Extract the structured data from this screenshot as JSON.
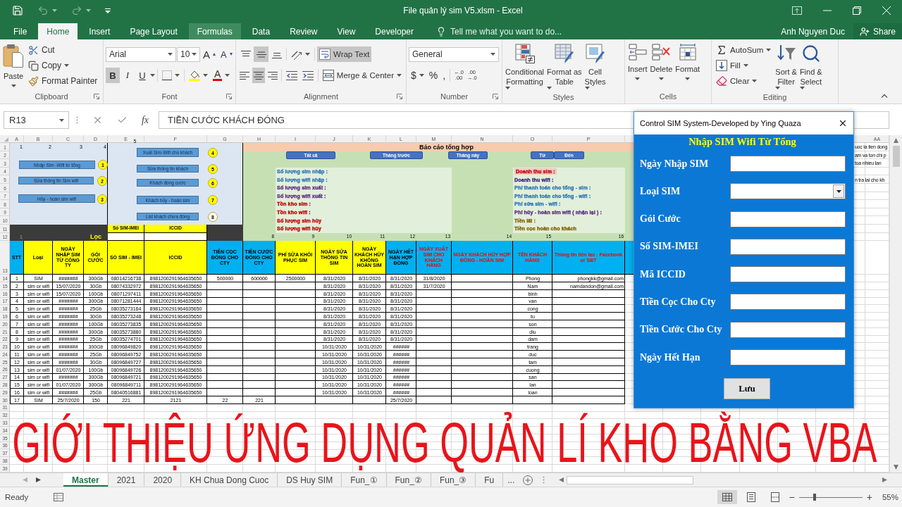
{
  "title_bar": {
    "title": "File quản lý sim V5.xlsm - Excel",
    "quick_access": [
      {
        "kind": "save",
        "disabled": false
      },
      {
        "kind": "undo",
        "disabled": true
      },
      {
        "kind": "redo",
        "disabled": true
      }
    ]
  },
  "ribbon_tabs": [
    {
      "label": "File",
      "selected": false,
      "highlighted": false
    },
    {
      "label": "Home",
      "selected": true,
      "highlighted": false
    },
    {
      "label": "Insert",
      "selected": false,
      "highlighted": false
    },
    {
      "label": "Page Layout",
      "selected": false,
      "highlighted": false
    },
    {
      "label": "Formulas",
      "selected": false,
      "highlighted": true
    },
    {
      "label": "Data",
      "selected": false,
      "highlighted": false
    },
    {
      "label": "Review",
      "selected": false,
      "highlighted": false
    },
    {
      "label": "View",
      "selected": false,
      "highlighted": false
    },
    {
      "label": "Developer",
      "selected": false,
      "highlighted": false
    }
  ],
  "tell_me": {
    "placeholder": "Tell me what you want to do..."
  },
  "account": {
    "user": "Anh Nguyen Duc",
    "share": "Share"
  },
  "ribbon": {
    "clipboard": {
      "label": "Clipboard",
      "paste": "Paste",
      "items": [
        {
          "kind": "cut",
          "label": "Cut"
        },
        {
          "kind": "copy",
          "label": "Copy"
        },
        {
          "kind": "format_painter",
          "label": "Format Painter"
        }
      ]
    },
    "font": {
      "label": "Font",
      "font_name": "Arial",
      "font_size": "10",
      "grow": "A",
      "shrink": "A",
      "styles": [
        {
          "kind": "bold",
          "label": "B",
          "on": true
        },
        {
          "kind": "italic",
          "label": "I",
          "on": false
        },
        {
          "kind": "underline",
          "label": "U",
          "on": false
        }
      ],
      "font_color": "A"
    },
    "alignment": {
      "label": "Alignment",
      "vertical": [
        {
          "kind": "top",
          "on": false
        },
        {
          "kind": "middle",
          "on": true
        },
        {
          "kind": "bottom",
          "on": false
        }
      ],
      "horizontal": [
        {
          "kind": "left",
          "on": false
        },
        {
          "kind": "center",
          "on": true
        },
        {
          "kind": "right",
          "on": false
        }
      ],
      "wrap_text": {
        "label": "Wrap Text",
        "on": true
      },
      "merge": "Merge & Center"
    },
    "number": {
      "label": "Number",
      "format": "General",
      "currency": "$",
      "percent": "%",
      "comma": ",",
      "decimals": [
        {
          "top": "←.0",
          "bottom": ".00"
        },
        {
          "top": ".00",
          "bottom": "→.0"
        }
      ]
    },
    "styles": {
      "label": "Styles",
      "buttons": [
        {
          "kind": "conditional_formatting",
          "lines": [
            "Conditional",
            "Formatting"
          ]
        },
        {
          "kind": "format_as_table",
          "lines": [
            "Format as",
            "Table"
          ]
        },
        {
          "kind": "cell_styles",
          "lines": [
            "Cell",
            "Styles"
          ]
        }
      ]
    },
    "cells": {
      "label": "Cells",
      "buttons": [
        {
          "kind": "insert",
          "label": "Insert"
        },
        {
          "kind": "delete",
          "label": "Delete"
        },
        {
          "kind": "format",
          "label": "Format"
        }
      ]
    },
    "editing": {
      "label": "Editing",
      "small": [
        {
          "kind": "autosum",
          "label": "AutoSum"
        },
        {
          "kind": "fill",
          "label": "Fill"
        },
        {
          "kind": "clear",
          "label": "Clear"
        }
      ],
      "large": [
        {
          "kind": "sort_filter",
          "lines": [
            "Sort &",
            "Filter"
          ]
        },
        {
          "kind": "find_select",
          "lines": [
            "Find &",
            "Select"
          ]
        }
      ]
    }
  },
  "formula_bar": {
    "name_box": "R13",
    "function_label": "fx",
    "formula": "TIỀN CƯỚC KHÁCH ĐÓNG"
  },
  "sheet": {
    "column_headers": [
      "A",
      "B",
      "C",
      "D",
      "E",
      "F",
      "G",
      "H",
      "I",
      "J",
      "K",
      "L",
      "M",
      "N",
      "O",
      "P"
    ],
    "far_column_header": "AA",
    "row_numbers": [
      "1",
      "2",
      "3",
      "4",
      "5",
      "6",
      "7",
      "8",
      "9",
      "10",
      "11",
      "12",
      "13",
      "14",
      "15",
      "16",
      "17",
      "18",
      "19",
      "20",
      "21",
      "22",
      "23",
      "24",
      "25",
      "26",
      "27",
      "28",
      "29",
      "30",
      "31",
      "32",
      "33",
      "34",
      "35",
      "36",
      "37",
      "38",
      "39"
    ],
    "row1_numbers": [
      "1",
      "2",
      "3",
      "4",
      "5"
    ],
    "side_notes": [
      "uoc la tien dong",
      "am va ton chi p",
      "toa nhieu lan",
      "n tra lai cho kh"
    ],
    "macros": [
      {
        "label": "Nhập Sim -Wifi từ tổng",
        "step": "1",
        "color": "#ffff00"
      },
      {
        "label": "Sửa thông tin Sim wifi",
        "step": "2",
        "color": "#ffff00"
      },
      {
        "label": "Hủy - hoàn sim wifi",
        "step": "3",
        "color": "#ffff00"
      },
      {
        "label": "Xuất Sim-Wifi cho khách",
        "step": "4",
        "color": "#ffff00"
      },
      {
        "label": "Sửa thông tin khách",
        "step": "5",
        "color": "#ffff00"
      },
      {
        "label": "Khách đóng cước",
        "step": "6",
        "color": "#ffff00"
      },
      {
        "label": "Khách hủy - hoàn sim",
        "step": "7",
        "color": "#ffff00"
      },
      {
        "label": "List khách chưa đóng",
        "step": "8",
        "color": "#ffffff"
      }
    ],
    "filter": {
      "count": "1",
      "title": "Lọc",
      "fields": [
        "Số SIM-IMEI",
        "ICCID"
      ]
    },
    "report": {
      "title": "Báo cáo tổng hợp",
      "buttons": [
        "Tất cả",
        "Tháng trước",
        "Tháng này",
        "Từ",
        "Đến"
      ],
      "counts": [
        {
          "text": "Số lượng sim nhập :",
          "color": "#2e75b6"
        },
        {
          "text": "Số lượng wifi nhập :",
          "color": "#2e75b6"
        },
        {
          "text": "Số lượng sim xuất :",
          "color": "#5b2c83"
        },
        {
          "text": "Số lượng wifi xuất :",
          "color": "#5b2c83"
        },
        {
          "text": "Tồn kho sim :",
          "color": "#c00000"
        },
        {
          "text": "Tồn kho wifi :",
          "color": "#c00000"
        },
        {
          "text": "Số lượng sim hủy",
          "color": "#c00000"
        },
        {
          "text": "Số lượng wifi hủy",
          "color": "#c00000"
        }
      ],
      "money": [
        {
          "text": "Doanh thu sim :",
          "color": "#c00000",
          "kind": "highlighted"
        },
        {
          "text": "Doanh thu wifi :",
          "color": "#3a1e78",
          "kind": "plain"
        },
        {
          "text": "Phí thanh toán cho tổng - sim :",
          "color": "#2e75b6",
          "kind": "plain"
        },
        {
          "text": "Phí thanh toán cho tổng - wifi :",
          "color": "#2e75b6",
          "kind": "plain"
        },
        {
          "text": "Phí sửa sim - wifi :",
          "color": "#2e75b6",
          "kind": "plain"
        },
        {
          "text": "Phí hủy - hoàn sim wifi ( nhận lại ) :",
          "color": "#5b2c83",
          "kind": "plain"
        },
        {
          "text": "Tiền lãi :",
          "color": "#7f6000",
          "kind": "plain"
        },
        {
          "text": "Tiền cọc hoàn cho khách",
          "color": "#7f6000",
          "kind": "plain"
        }
      ],
      "column_numbers": [
        "8",
        "9",
        "10",
        "11",
        "12",
        "13",
        "14",
        "15",
        "16"
      ]
    },
    "table": {
      "headers": [
        {
          "text": "STT",
          "color": "#00b0f0",
          "kind": "normal"
        },
        {
          "text": "Loại",
          "color": "#ffff00",
          "kind": "normal"
        },
        {
          "text": "NGÀY NHẬP SIM TỪ CÔNG TY",
          "color": "#ffff00",
          "kind": "normal"
        },
        {
          "text": "GÓI CƯỚC",
          "color": "#ffff00",
          "kind": "normal"
        },
        {
          "text": "SỐ SIM - IMEI",
          "color": "#ffff00",
          "kind": "normal"
        },
        {
          "text": "ICCID",
          "color": "#ffff00",
          "kind": "normal"
        },
        {
          "text": "TIỀN CỌC ĐÓNG CHO CTY",
          "color": "#00b0f0",
          "kind": "normal"
        },
        {
          "text": "TIỀN CƯỚC ĐÓNG CHO CTY",
          "color": "#00b0f0",
          "kind": "normal"
        },
        {
          "text": "PHÍ SỬA KHÔI PHỤC SIM",
          "color": "#ffff00",
          "kind": "normal"
        },
        {
          "text": "NGÀY SỬA THÔNG TIN SIM",
          "color": "#ffff00",
          "kind": "normal"
        },
        {
          "text": "NGÀY KHÁCH HỦY KHÔNG HOÀN SIM",
          "color": "#ffff00",
          "kind": "normal"
        },
        {
          "text": "NGÀY HẾT HẠN HỢP ĐỒNG",
          "color": "#00b0f0",
          "kind": "normal"
        },
        {
          "text": "NGÀY XUẤT SIM CHO KHÁCH HÀNG",
          "color": "#00b0f0",
          "kind": "alert"
        },
        {
          "text": "NGÀY KHÁCH HỦY HỢP ĐỒNG - HOÀN SIM",
          "color": "#00b0f0",
          "kind": "alert"
        },
        {
          "text": "TÊN KHÁCH HÀNG",
          "color": "#00b0f0",
          "kind": "alert"
        },
        {
          "text": "Thông tin liên lạc : Facebook or SĐT",
          "color": "#00b0f0",
          "kind": "alert"
        }
      ],
      "rows": [
        [
          "1",
          "SIM",
          "#######",
          "300Gb",
          "08014216738",
          "8981200291964635650",
          "500000",
          "600000",
          "2500000",
          "8/31/2020",
          "8/31/2020",
          "8/31/2020",
          "31/8/2020",
          null,
          "Phong",
          "phongkk@gmail.com"
        ],
        [
          "2",
          "sim or wifi",
          "15/07/2020",
          "30Gb",
          "08074332972",
          "8981200291964635650",
          null,
          null,
          null,
          "8/31/2020",
          "8/31/2020",
          "8/31/2020",
          "31/7/2020",
          null,
          "Nam",
          "namdandon@gmail.com"
        ],
        [
          "3",
          "sim or wifi",
          "15/07/2020",
          "100Gb",
          "08071297411",
          "8981200291964635650",
          null,
          null,
          null,
          "8/31/2020",
          "8/31/2020",
          "8/31/2020",
          null,
          null,
          "binh",
          null
        ],
        [
          "4",
          "sim or wifi",
          "#######",
          "300Gb",
          "08071281444",
          "8981200291964635650",
          null,
          null,
          null,
          "8/31/2020",
          "8/31/2020",
          "8/31/2020",
          null,
          null,
          "van",
          null
        ],
        [
          "5",
          "sim or wifi",
          "#######",
          "25Gb",
          "08035273164",
          "8981200291964635650",
          null,
          null,
          null,
          "8/31/2020",
          "8/31/2020",
          "8/31/2020",
          null,
          null,
          "cong",
          null
        ],
        [
          "6",
          "sim or wifi",
          "#######",
          "30Gb",
          "08035273248",
          "8981200291964635650",
          null,
          null,
          null,
          "8/31/2020",
          "8/31/2020",
          "8/31/2020",
          null,
          null,
          "tu",
          null
        ],
        [
          "7",
          "sim or wifi",
          "#######",
          "100Gb",
          "08035273835",
          "8981200291964635650",
          null,
          null,
          null,
          "8/31/2020",
          "8/31/2020",
          "8/31/2020",
          null,
          null,
          "son",
          null
        ],
        [
          "8",
          "sim or wifi",
          "#######",
          "300Gb",
          "08035273880",
          "8981200291964635650",
          null,
          null,
          null,
          "8/31/2020",
          "8/31/2020",
          "8/31/2020",
          null,
          null,
          "diu",
          null
        ],
        [
          "9",
          "sim or wifi",
          "#######",
          "25Gb",
          "08035274701",
          "8981200291964635650",
          null,
          null,
          null,
          "8/31/2020",
          "8/31/2020",
          "8/31/2020",
          null,
          null,
          "dam",
          null
        ],
        [
          "10",
          "sim or wifi",
          "#######",
          "300Gb",
          "08096849820",
          "8981200291964635650",
          null,
          null,
          null,
          "10/31/2020",
          "10/31/2020",
          "######",
          null,
          null,
          "trang",
          null
        ],
        [
          "11",
          "sim or wifi",
          "#######",
          "25Gb",
          "08096849752",
          "8981200291964635650",
          null,
          null,
          null,
          "10/31/2020",
          "10/31/2020",
          "######",
          null,
          null,
          "duc",
          null
        ],
        [
          "12",
          "sim or wifi",
          "#######",
          "30Gb",
          "08096849727",
          "8981200291964635650",
          null,
          null,
          null,
          "10/31/2020",
          "10/31/2020",
          "######",
          null,
          null,
          "tam",
          null
        ],
        [
          "13",
          "sim or wifi",
          "01/07/2020",
          "100Gb",
          "08096849726",
          "8981200291964635650",
          null,
          null,
          null,
          "10/31/2020",
          "10/31/2020",
          "######",
          null,
          null,
          "cuong",
          null
        ],
        [
          "14",
          "sim or wifi",
          "#######",
          "300Gb",
          "08096849721",
          "8981200291964635650",
          null,
          null,
          null,
          "10/31/2020",
          "10/31/2020",
          "######",
          null,
          null,
          "san",
          null
        ],
        [
          "15",
          "sim or wifi",
          "01/07/2020",
          "300Gb",
          "08096849711",
          "8981200291964635650",
          null,
          null,
          null,
          "10/31/2020",
          "10/31/2020",
          "######",
          null,
          null,
          "lan",
          null
        ],
        [
          "16",
          "sim or wifi",
          "#######",
          "25Gb",
          "08040516881",
          "8981200291964635650",
          null,
          null,
          null,
          "10/31/2020",
          "10/31/2020",
          "######",
          null,
          null,
          "loan",
          null
        ],
        [
          "17",
          "SIM",
          "25/7/2020",
          "150",
          "221",
          "2121",
          "22",
          "221",
          null,
          null,
          null,
          "25/7/2020",
          null,
          null,
          null,
          null
        ]
      ]
    }
  },
  "overlay_title": "GIỚI THIỆU ỨNG DỤNG QUẢN LÍ KHO BẰNG VBA",
  "dialog": {
    "title": "Control SIM System-Developed by Ying Quaza",
    "heading": "Nhập SIM Wifi Từ Tổng",
    "fields": [
      {
        "label": "Ngày Nhập SIM",
        "kind": "text"
      },
      {
        "label": "Loại SIM",
        "kind": "combo"
      },
      {
        "label": "Gói Cước",
        "kind": "text"
      },
      {
        "label": "Số SIM-IMEI",
        "kind": "text"
      },
      {
        "label": "Mã ICCID",
        "kind": "text"
      },
      {
        "label": "Tiền Cọc Cho Cty",
        "kind": "text"
      },
      {
        "label": "Tiền Cước Cho Cty",
        "kind": "text"
      },
      {
        "label": "Ngày Hết Hạn",
        "kind": "text"
      }
    ],
    "save_button": "Lưu"
  },
  "sheet_tabs": {
    "tabs": [
      {
        "label": "Master",
        "selected": true
      },
      {
        "label": "2021",
        "selected": false
      },
      {
        "label": "2020",
        "selected": false
      },
      {
        "label": "KH Chua Dong Cuoc",
        "selected": false
      },
      {
        "label": "DS Huy SIM",
        "selected": false
      },
      {
        "label": "Fun_①",
        "selected": false
      },
      {
        "label": "Fun_②",
        "selected": false
      },
      {
        "label": "Fun_③",
        "selected": false
      },
      {
        "label": "Fu",
        "selected": false
      }
    ],
    "more": "..."
  },
  "status_bar": {
    "status": "Ready",
    "views": [
      {
        "kind": "normal",
        "selected": true
      },
      {
        "kind": "page_layout",
        "selected": false
      },
      {
        "kind": "page_break",
        "selected": false
      }
    ],
    "zoom_out": "−",
    "zoom_slider": {
      "level": 0.25
    },
    "zoom_in": "+",
    "zoom": "55%"
  }
}
